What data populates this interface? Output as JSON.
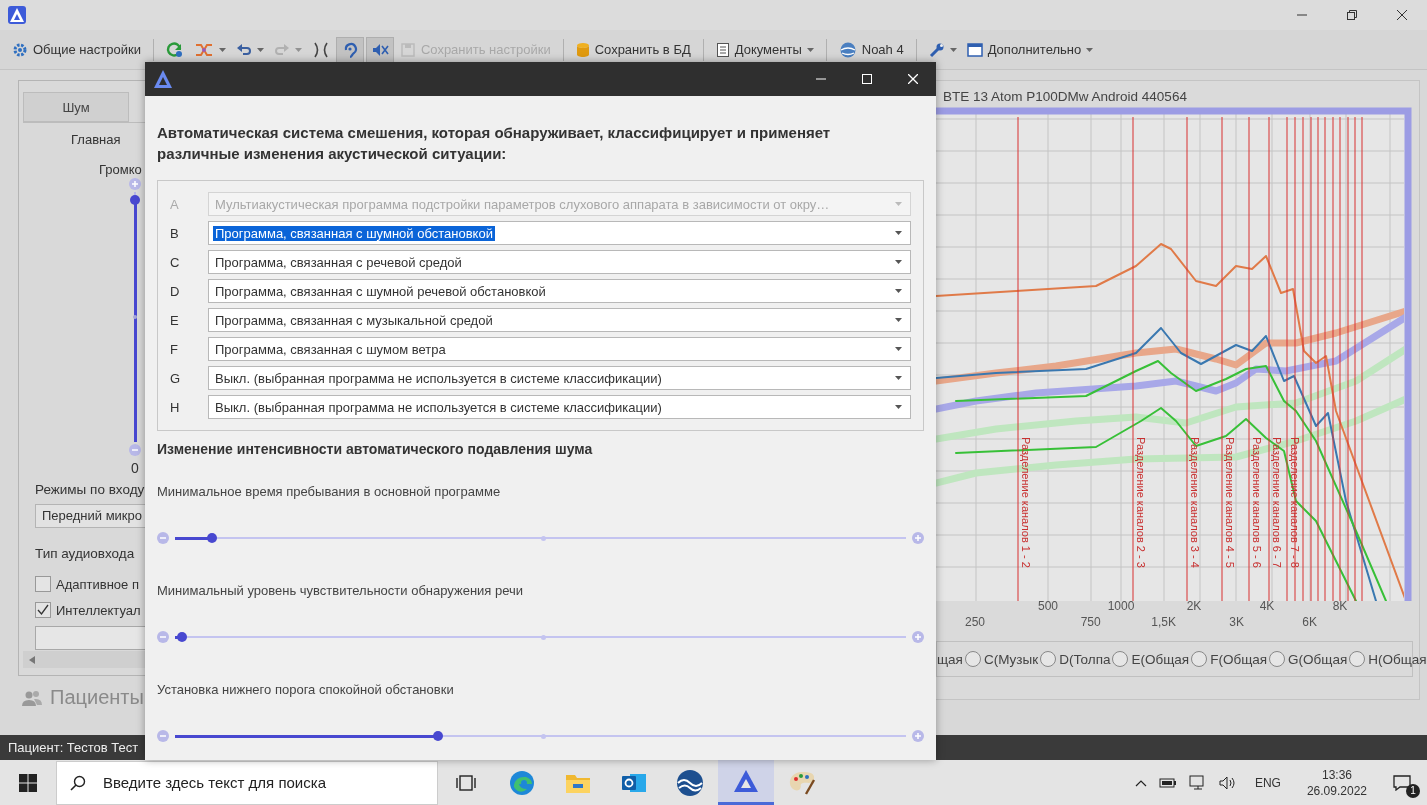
{
  "toolbar": [
    {
      "kind": "labeled",
      "label": "Общие настройки",
      "disabled": false,
      "pressed": false,
      "dropdown": false
    },
    {
      "kind": "icon",
      "disabled": false,
      "pressed": false,
      "dropdown": false
    },
    {
      "kind": "icon",
      "disabled": false,
      "pressed": false,
      "dropdown": true
    },
    {
      "kind": "icon",
      "disabled": false,
      "pressed": false,
      "dropdown": true
    },
    {
      "kind": "icon",
      "disabled": true,
      "pressed": false,
      "dropdown": true
    },
    {
      "kind": "icon",
      "disabled": false,
      "pressed": false,
      "dropdown": false
    },
    {
      "kind": "icon",
      "disabled": false,
      "pressed": true,
      "dropdown": false
    },
    {
      "kind": "icon",
      "disabled": false,
      "pressed": true,
      "dropdown": false
    },
    {
      "kind": "labeled",
      "label": "Сохранить настройки",
      "disabled": true,
      "pressed": false,
      "dropdown": false
    },
    {
      "kind": "labeled",
      "label": "Сохранить в БД",
      "disabled": false,
      "pressed": false,
      "dropdown": false
    },
    {
      "kind": "labeled",
      "label": "Документы",
      "disabled": false,
      "pressed": false,
      "dropdown": true
    },
    {
      "kind": "labeled",
      "label": "Noah 4",
      "disabled": false,
      "pressed": false,
      "dropdown": false
    },
    {
      "kind": "icon",
      "disabled": false,
      "pressed": false,
      "dropdown": true
    },
    {
      "kind": "labeled",
      "label": "Дополнительно",
      "disabled": false,
      "pressed": false,
      "dropdown": true
    }
  ],
  "left_panel": {
    "tabs": [
      {
        "label": "Шум",
        "selected": false
      }
    ],
    "subtitle": "Главная",
    "volume_label": "Громко",
    "volume": {
      "level": 0.97
    },
    "volume_value": "0",
    "input_modes_label": "Режимы по входу",
    "input_mode_value": "Передний микро",
    "audio_input_label": "Тип аудиовхода",
    "checkboxes": [
      {
        "label": "Адаптивное п",
        "checked": false
      },
      {
        "label": "Интеллектуал",
        "checked": true
      }
    ]
  },
  "patients_label": "Пациенты",
  "chart": {
    "title": "BTE 13 Atom P100DMw Android 440564",
    "x_labels_upper": [
      "500",
      "1000",
      "2K",
      "4K",
      "8K"
    ],
    "x_labels_lower": [
      "250",
      "750",
      "1,5K",
      "3K",
      "6K"
    ],
    "channel_dividers": [
      "Разделение каналов 1 - 2",
      "Разделение каналов 2 - 3",
      "Разделение каналов 3 - 4",
      "Разделение каналов 4 - 5",
      "Разделение каналов 5 - 6",
      "Разделение каналов 6 - 7",
      "Разделение каналов 7 - 8"
    ],
    "programs": [
      {
        "label": "щая"
      },
      {
        "label": "C(Музык",
        "selected": false
      },
      {
        "label": "D(Толпа",
        "selected": false
      },
      {
        "label": "E(Общая",
        "selected": false
      },
      {
        "label": "F(Общая",
        "selected": false
      },
      {
        "label": "G(Общая",
        "selected": false
      },
      {
        "label": "H(Общая",
        "selected": false
      }
    ]
  },
  "status_bar": "Пациент: Тестов Тест",
  "dialog": {
    "heading": "Автоматическая система смешения, которая обнаруживает, классифицирует и применяет различные изменения акустической ситуации:",
    "rows": [
      {
        "letter": "A",
        "value": "Мультиакустическая программа подстройки параметров слухового аппарата в зависимости от окру…",
        "disabled": true,
        "highlighted": false
      },
      {
        "letter": "B",
        "value": "Программа, связанная с шумной обстановкой",
        "disabled": false,
        "highlighted": true
      },
      {
        "letter": "C",
        "value": "Программа, связанная с речевой средой",
        "disabled": false,
        "highlighted": false
      },
      {
        "letter": "D",
        "value": "Программа, связанная с шумной речевой обстановкой",
        "disabled": false,
        "highlighted": false
      },
      {
        "letter": "E",
        "value": "Программа, связанная с музыкальной средой",
        "disabled": false,
        "highlighted": false
      },
      {
        "letter": "F",
        "value": "Программа, связанная с шумом ветра",
        "disabled": false,
        "highlighted": false
      },
      {
        "letter": "G",
        "value": "Выкл. (выбранная программа не используется в системе классификации)",
        "disabled": false,
        "highlighted": false
      },
      {
        "letter": "H",
        "value": "Выкл. (выбранная программа не используется в системе классификации)",
        "disabled": false,
        "highlighted": false
      }
    ],
    "section_heading": "Изменение интенсивности автоматического подавления шума",
    "sliders": [
      {
        "label": "Минимальное время пребывания в основной программе",
        "level": 0.05
      },
      {
        "label": "Минимальный уровень чувствительности обнаружения речи",
        "level": 0.01
      },
      {
        "label": "Установка нижнего порога спокойной обстановки",
        "level": 0.36
      }
    ]
  },
  "taskbar": {
    "search_placeholder": "Введите здесь текст для поиска",
    "language": "ENG",
    "time": "13:36",
    "date": "26.09.2022",
    "notifications": "1"
  }
}
